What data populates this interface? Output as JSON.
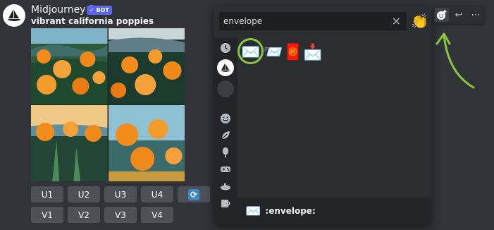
{
  "message": {
    "username": "Midjourney Bot",
    "bot_tag": "✓ BOT",
    "prompt": "vibrant california poppies"
  },
  "buttons": {
    "upscale": [
      "U1",
      "U2",
      "U3",
      "U4"
    ],
    "variation": [
      "V1",
      "V2",
      "V3",
      "V4"
    ],
    "reroll_icon": "refresh-icon"
  },
  "emoji_picker": {
    "search_value": "envelope",
    "clear_icon": "×",
    "skin_tone_icon": "👏",
    "results": [
      {
        "glyph": "✉️",
        "name": "envelope"
      },
      {
        "glyph": "📨",
        "name": "incoming_envelope"
      },
      {
        "glyph": "🧧",
        "name": "red_envelope"
      },
      {
        "glyph": "📩",
        "name": "envelope_with_arrow"
      }
    ],
    "preview": {
      "glyph": "✉️",
      "label": ":envelope:"
    },
    "categories": [
      "clock-icon",
      "midjourney-server-icon",
      "server-icon",
      "smiley-icon",
      "leaf-icon",
      "popsicle-icon",
      "gamepad-icon",
      "submarine-icon",
      "mug-icon"
    ]
  },
  "message_actions": {
    "add_reaction_icon": "add-reaction-icon",
    "reply_icon": "↩",
    "more_icon": "⋯"
  },
  "colors": {
    "highlight": "#8cc63f",
    "blurple": "#5865f2"
  }
}
